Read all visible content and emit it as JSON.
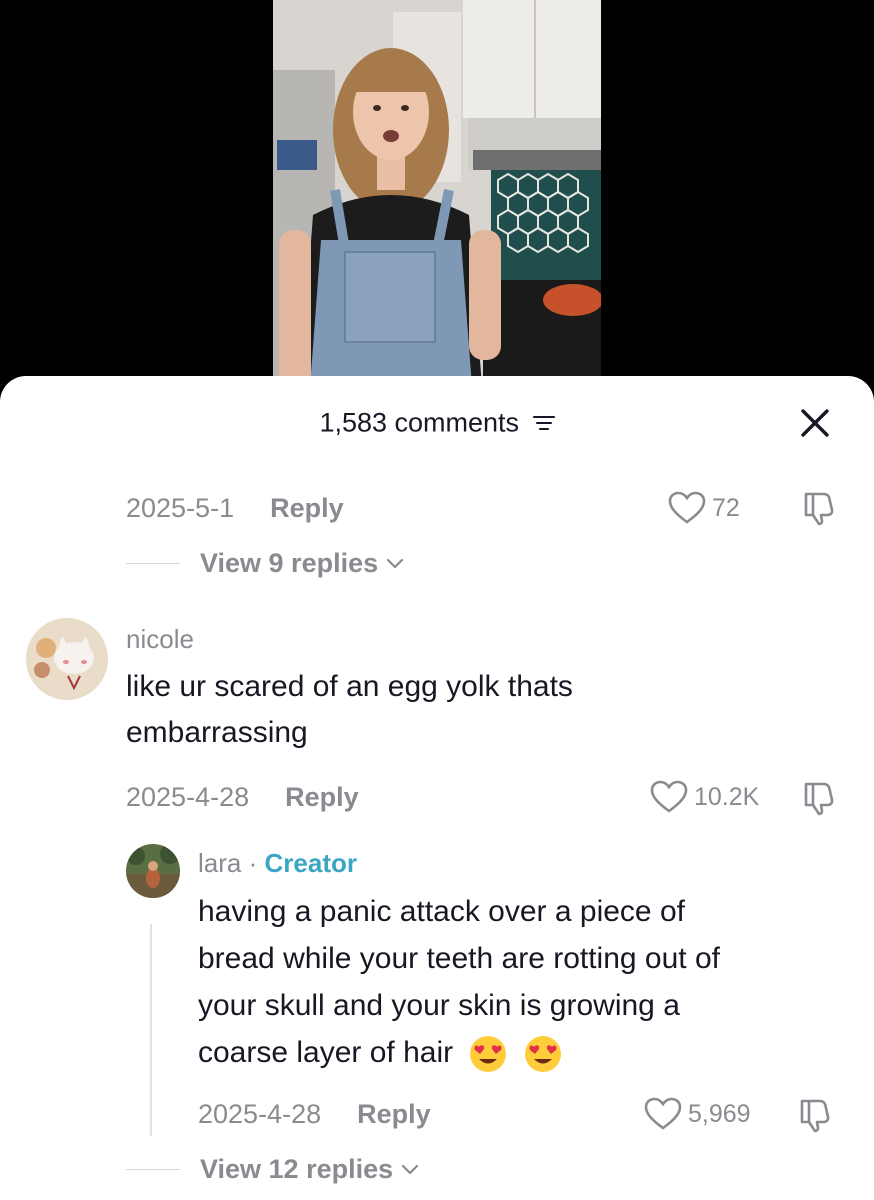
{
  "header": {
    "comment_count": "1,583 comments"
  },
  "comments": {
    "prev": {
      "date": "2025-5-1",
      "reply": "Reply",
      "likes": "72",
      "view_replies": "View 9 replies"
    },
    "nicole": {
      "username": "nicole",
      "text_line1": "like ur scared of an egg yolk thats",
      "text_line2": "embarrassing",
      "date": "2025-4-28",
      "reply": "Reply",
      "likes": "10.2K"
    },
    "lara": {
      "username": "lara",
      "separator": "·",
      "creator_badge": "Creator",
      "text_line1": "having a panic attack over a piece of",
      "text_line2": "bread while your teeth are rotting out of",
      "text_line3": "your skull and your skin is growing a",
      "text_line4": "coarse layer of hair",
      "emojis": [
        "heart-eyes-emoji",
        "heart-eyes-emoji"
      ],
      "date": "2025-4-28",
      "reply": "Reply",
      "likes": "5,969",
      "view_replies": "View 12 replies"
    }
  },
  "colors": {
    "accent_creator": "#3aa6c4",
    "text_primary": "#161823",
    "text_secondary": "#8a8b91"
  }
}
